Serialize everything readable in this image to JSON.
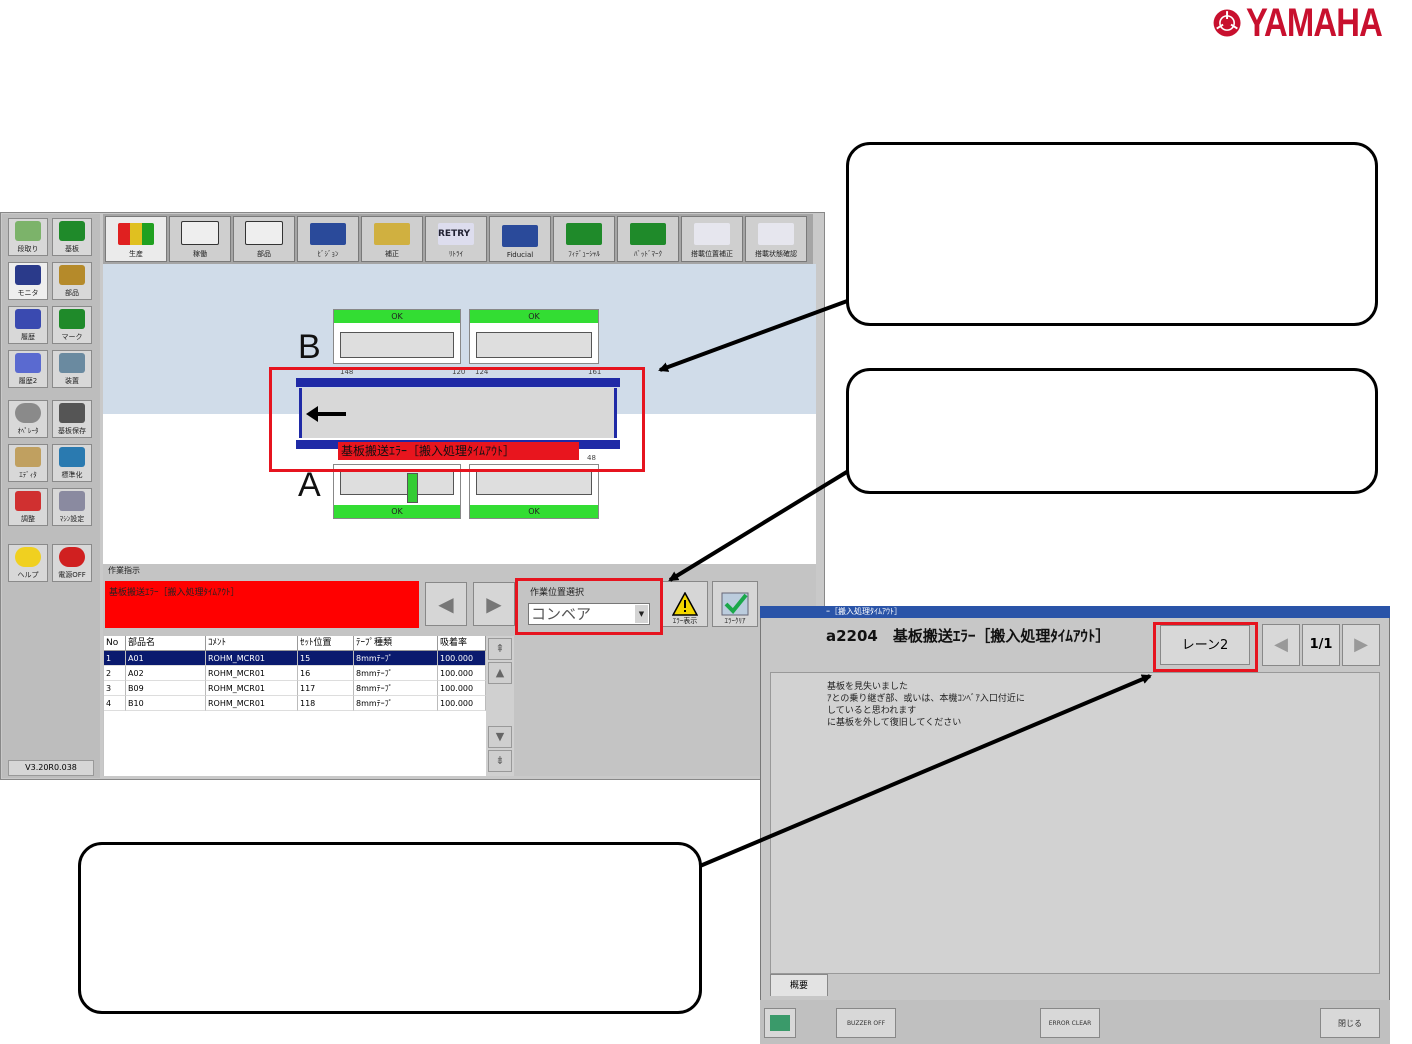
{
  "logo": {
    "text": "YAMAHA"
  },
  "left_panel": {
    "buttons": [
      {
        "label": "段取り"
      },
      {
        "label": "基板"
      },
      {
        "label": "モニタ"
      },
      {
        "label": "部品"
      },
      {
        "label": "履歴"
      },
      {
        "label": "マーク"
      },
      {
        "label": "履歴2"
      },
      {
        "label": "装置"
      },
      {
        "label": "ｵﾍﾟﾚｰﾀ"
      },
      {
        "label": "基板保存"
      },
      {
        "label": "ｴﾃﾞｨﾀ"
      },
      {
        "label": "標準化"
      },
      {
        "label": "調整"
      },
      {
        "label": "ﾏｼﾝ設定"
      },
      {
        "label": "ヘルプ"
      },
      {
        "label": "電源OFF"
      }
    ],
    "version": "V3.20R0.038"
  },
  "toolbar": {
    "tabs": [
      {
        "label": "生産"
      },
      {
        "label": "稼働"
      },
      {
        "label": "部品"
      },
      {
        "label": "ﾋﾞｼﾞｮﾝ"
      },
      {
        "label": "補正"
      },
      {
        "label": "ﾘﾄﾗｲ"
      },
      {
        "label": "Fiducial"
      },
      {
        "label": "ﾌｨﾃﾞｭｰｼｬﾙ"
      },
      {
        "label": "ﾊﾞｯﾄﾞﾏｰｸ"
      },
      {
        "label": "搭載位置補正"
      },
      {
        "label": "搭載状態確認"
      }
    ],
    "retry_icon_text": "RETRY"
  },
  "conveyor_view": {
    "lane_b_label": "B",
    "lane_a_label": "A",
    "slot_status_ok": "OK",
    "ruler": {
      "t1": "148",
      "t2": "120",
      "t3": "124",
      "t4": "161",
      "t5": "48"
    },
    "error_banner": "基板搬送ｴﾗｰ［搬入処理ﾀｲﾑｱｳﾄ］"
  },
  "work_instruction": {
    "label": "作業指示",
    "text": "基板搬送ｴﾗｰ［搬入処理ﾀｲﾑｱｳﾄ］"
  },
  "parts_table": {
    "columns": [
      "No",
      "部品名",
      "ｺﾒﾝﾄ",
      "ｾｯﾄ位置",
      "ﾃｰﾌﾟ種類",
      "吸着率"
    ],
    "rows": [
      [
        "1",
        "A01",
        "ROHM_MCR01",
        "15",
        "8mmﾃｰﾌﾟ",
        "100.000"
      ],
      [
        "2",
        "A02",
        "ROHM_MCR01",
        "16",
        "8mmﾃｰﾌﾟ",
        "100.000"
      ],
      [
        "3",
        "B09",
        "ROHM_MCR01",
        "117",
        "8mmﾃｰﾌﾟ",
        "100.000"
      ],
      [
        "4",
        "B10",
        "ROHM_MCR01",
        "118",
        "8mmﾃｰﾌﾟ",
        "100.000"
      ]
    ]
  },
  "position_select": {
    "label": "作業位置選択",
    "value": "コンベア"
  },
  "action_buttons": {
    "error_display": "ｴﾗｰ表示",
    "error_clear": "ｴﾗｰｸﾘｱ"
  },
  "error_dialog": {
    "title": "ｰ［搬入処理ﾀｲﾑｱｳﾄ］",
    "code_title": "a2204　基板搬送ｴﾗｰ［搬入処理ﾀｲﾑｱｳﾄ］",
    "lane_button": "レーン2",
    "page": "1/1",
    "message": "基板を見失いました\nｱとの乗り継ぎ部、或いは、本機ｺﾝﾍﾞｱ入口付近に\nしていると思われます\nに基板を外して復旧してください",
    "tab_label": "概要",
    "footer": {
      "btn1": "BUZZER OFF",
      "btn2": "ERROR CLEAR",
      "btn3": "閉じる"
    }
  },
  "colors": {
    "highlight": "#e6141f",
    "conveyor_blue": "#1f2aa6",
    "ok_green": "#33dd33",
    "error_red": "#ff0000",
    "logo_red": "#c8102e"
  }
}
